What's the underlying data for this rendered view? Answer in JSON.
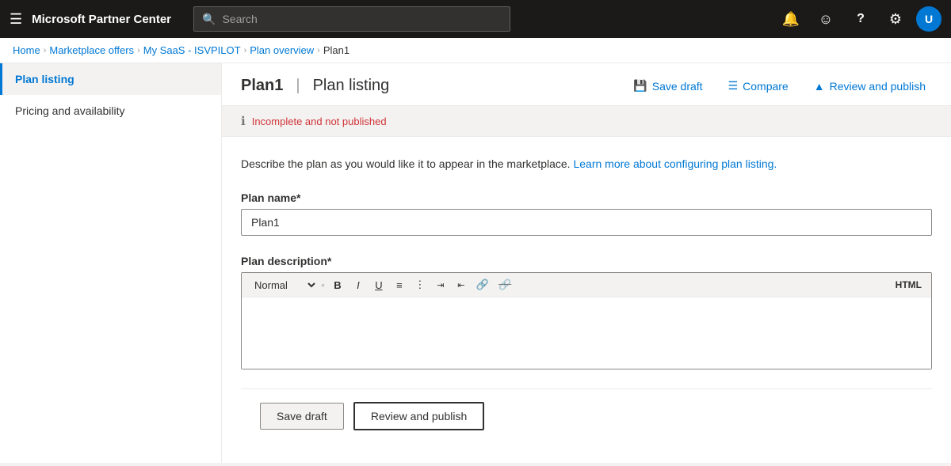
{
  "app": {
    "title": "Microsoft Partner Center"
  },
  "topnav": {
    "search_placeholder": "Search",
    "icons": {
      "bell": "🔔",
      "smiley": "☺",
      "help": "?",
      "settings": "⚙",
      "avatar_initials": "U"
    }
  },
  "breadcrumb": {
    "items": [
      {
        "label": "Home",
        "link": true
      },
      {
        "label": "Marketplace offers",
        "link": true
      },
      {
        "label": "My SaaS - ISVPILOT",
        "link": true
      },
      {
        "label": "Plan overview",
        "link": true
      },
      {
        "label": "Plan1",
        "link": false
      }
    ]
  },
  "sidebar": {
    "items": [
      {
        "label": "Plan listing",
        "active": true
      },
      {
        "label": "Pricing and availability",
        "active": false
      }
    ]
  },
  "page": {
    "title": "Plan1",
    "separator": "|",
    "subtitle": "Plan listing",
    "actions": {
      "save_draft": "Save draft",
      "compare": "Compare",
      "review_publish": "Review and publish"
    }
  },
  "status": {
    "icon": "ℹ",
    "text": "Incomplete and not published"
  },
  "content": {
    "description": "Describe the plan as you would like it to appear in the marketplace.",
    "description_link_text": "Learn more about configuring plan listing.",
    "plan_name_label": "Plan name*",
    "plan_name_value": "Plan1",
    "plan_description_label": "Plan description*",
    "rte": {
      "format_label": "Normal",
      "toolbar_items": [
        "B",
        "I",
        "U",
        "OL",
        "UL",
        "IND+",
        "IND-",
        "LINK",
        "UNLINK"
      ],
      "html_label": "HTML"
    }
  },
  "bottom_actions": {
    "save_draft": "Save draft",
    "review_publish": "Review and publish"
  }
}
